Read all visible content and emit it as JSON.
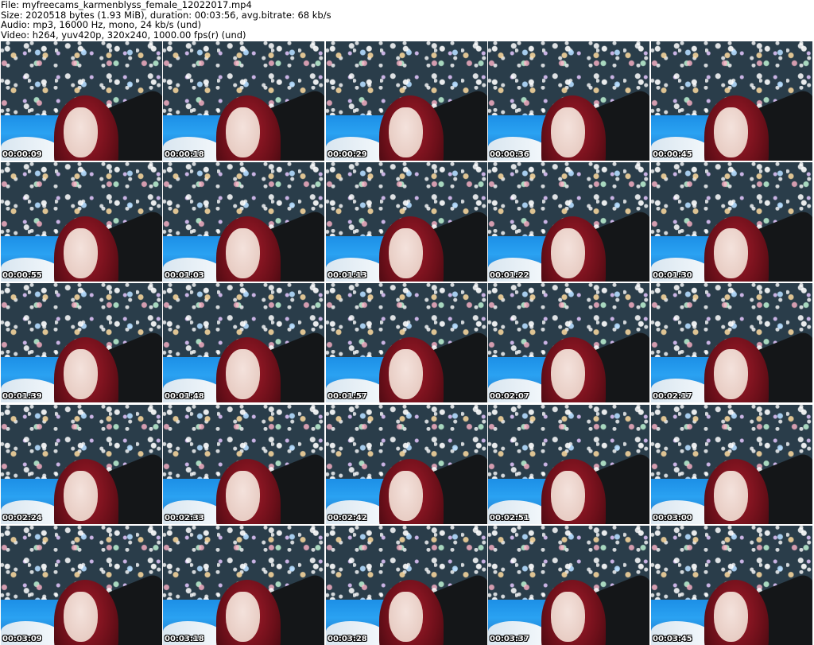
{
  "header": {
    "file": "File: myfreecams_karmenblyss_female_12022017.mp4",
    "size": "Size: 2020518 bytes (1.93 MiB), duration: 00:03:56, avg.bitrate: 68 kb/s",
    "audio": "Audio: mp3, 16000 Hz, mono, 24 kb/s (und)",
    "video": "Video: h264, yuv420p, 320x240, 1000.00 fps(r) (und)"
  },
  "thumbnails": [
    "00:00:09",
    "00:00:18",
    "00:00:29",
    "00:00:36",
    "00:00:45",
    "00:00:55",
    "00:01:03",
    "00:01:13",
    "00:01:22",
    "00:01:30",
    "00:01:39",
    "00:01:48",
    "00:01:57",
    "00:02:07",
    "00:02:17",
    "00:02:24",
    "00:02:33",
    "00:02:42",
    "00:02:51",
    "00:03:00",
    "00:03:09",
    "00:03:18",
    "00:03:28",
    "00:03:37",
    "00:03:45"
  ]
}
